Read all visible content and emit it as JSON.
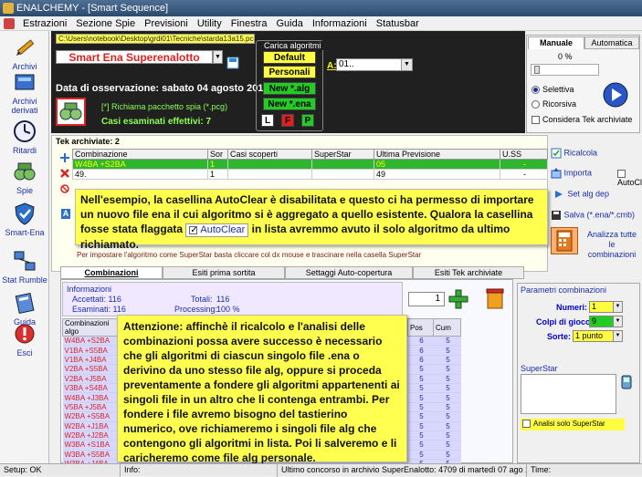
{
  "window": {
    "title": "ENALCHEMY - [Smart Sequence]"
  },
  "menu": [
    "Estrazioni",
    "Sezione Spie",
    "Previsioni",
    "Utility",
    "Finestra",
    "Guida",
    "Informazioni",
    "Statusbar"
  ],
  "sidebar": [
    "Archivi",
    "Archivi derivati",
    "Ritardi",
    "Spie",
    "Smart-Ena",
    "Stat Rumble",
    "Guida",
    "Esci"
  ],
  "top": {
    "path": "C:\\Users\\notebook\\Desktop\\grdi01\\Tecniche\\starda13a15.pcg",
    "game": "Smart Ena Superenalotto",
    "date_label": "Data di osservazione:",
    "date_value": "sabato 04 agosto 2012",
    "spy_note": "[*] Richiama pacchetto spia (*.pcg)",
    "cases_label": "Casi esaminati effettivi: 7"
  },
  "carica": {
    "legend": "Carica algoritmi",
    "buttons": [
      "Default",
      "Personali",
      "New *.alg",
      "New *.ena"
    ],
    "small": [
      "L",
      "F",
      "P"
    ],
    "a_label": "A:",
    "a_value": "01.."
  },
  "right_panel": {
    "tabs": [
      "Manuale",
      "Automatica"
    ],
    "percent": "0 %",
    "radio1": "Selettiva",
    "radio2": "Ricorsiva",
    "check": "Considera Tek archiviate"
  },
  "tek": {
    "title": "Tek archiviate: 2",
    "headers": [
      "Combinazione",
      "Sor",
      "Casi scoperti",
      "SuperStar",
      "Ultima Previsione",
      "U.SS"
    ],
    "rows": [
      {
        "comb": "W4BA +S2BA",
        "sor": "1",
        "casi": "",
        "ss": "",
        "prev": "05",
        "uss": "-"
      },
      {
        "comb": "49.",
        "sor": "1",
        "casi": "",
        "ss": "",
        "prev": "49",
        "uss": "-"
      }
    ],
    "hint": "Per impostare l'algoritmo come SuperStar basta cliccare col dx mouse e trascinare nella casella SuperStar"
  },
  "tools": {
    "ricalcola": "Ricalcola",
    "importa": "Importa",
    "autoclear": "AutoClear",
    "setalg": "Set alg dep",
    "salva": "Salva (*.ena/*.cmb)",
    "analizza": "Analizza tutte le combinazioni"
  },
  "note1": {
    "before": "Nell'esempio, la casellina AutoClear è disabilitata e questo ci ha permesso di importare un nuovo file ena il cui algoritmo si è aggregato a quello esistente. Qualora la casellina fosse stata flaggata",
    "chip": "AutoClear",
    "after": "in lista avremmo avuto il solo algoritmo da ultimo richiamato."
  },
  "bottom_tabs": [
    "Combinazioni algoritmiche",
    "Esiti prima sortita",
    "Settaggi Auto-copertura",
    "Esiti Tek archiviate"
  ],
  "info": {
    "title": "Informazioni",
    "accettati": "Accettati: 116",
    "esaminati": "Esaminati: 116",
    "totali": "Totali:",
    "totali_val": "116",
    "processing": "Processing:",
    "processing_val": "100 %",
    "spin": "1"
  },
  "comb_table": {
    "headers": [
      "Combinazioni algo",
      "Pos",
      "Cum"
    ],
    "rows": [
      {
        "c": "W4BA +S2BA",
        "p": "6",
        "m": "5"
      },
      {
        "c": "V1BA +S5BA",
        "p": "6",
        "m": "5"
      },
      {
        "c": "V1BA +J4BA",
        "p": "6",
        "m": "5"
      },
      {
        "c": "V2BA +S5BA",
        "p": "5",
        "m": "5"
      },
      {
        "c": "V2BA +J5BA",
        "p": "5",
        "m": "5"
      },
      {
        "c": "V3BA +S4BA",
        "p": "5",
        "m": "5"
      },
      {
        "c": "W4BA +J3BA",
        "p": "5",
        "m": "5"
      },
      {
        "c": "V5BA +J5BA",
        "p": "5",
        "m": "5"
      },
      {
        "c": "W2BA +S5BA",
        "p": "5",
        "m": "5"
      },
      {
        "c": "W2BA +J1BA",
        "p": "5",
        "m": "5"
      },
      {
        "c": "W2BA +J2BA",
        "p": "5",
        "m": "5"
      },
      {
        "c": "W3BA +S1BA",
        "p": "5",
        "m": "5"
      },
      {
        "c": "W3BA +S5BA",
        "p": "5",
        "m": "5"
      },
      {
        "c": "W3BA +J4BA",
        "p": "5",
        "m": "5"
      }
    ]
  },
  "note2": "Attenzione: affinchè il ricalcolo e l'analisi delle combinazioni possa avere successo è necessario che gli algoritmi di ciascun singolo file .ena o derivino da uno stesso file alg, oppure si proceda preventamente a fondere gli algoritmi appartenenti ai singoli file in un altro che li contenga entrambi. Per fondere i file avremo bisogno del tastierino numerico, ove richiameremo i singoli file alg che contengono gli algoritmi in lista. Poi li salveremo e li caricheremo come file alg personale.",
  "params": {
    "title": "Parametri combinazioni",
    "numeri_label": "Numeri:",
    "numeri": "1",
    "colpi_label": "Colpi di gioco:",
    "colpi": "9",
    "sorte_label": "Sorte:",
    "sorte": "1 punto",
    "superstar": "SuperStar",
    "analisi": "Analisi solo SuperStar"
  },
  "status": {
    "setup": "Setup: OK",
    "info": "Info:",
    "ultimo": "Ultimo concorso in archivio SuperEnalotto: 4709 di martedì 07 ago 2012",
    "time": "Time:"
  }
}
